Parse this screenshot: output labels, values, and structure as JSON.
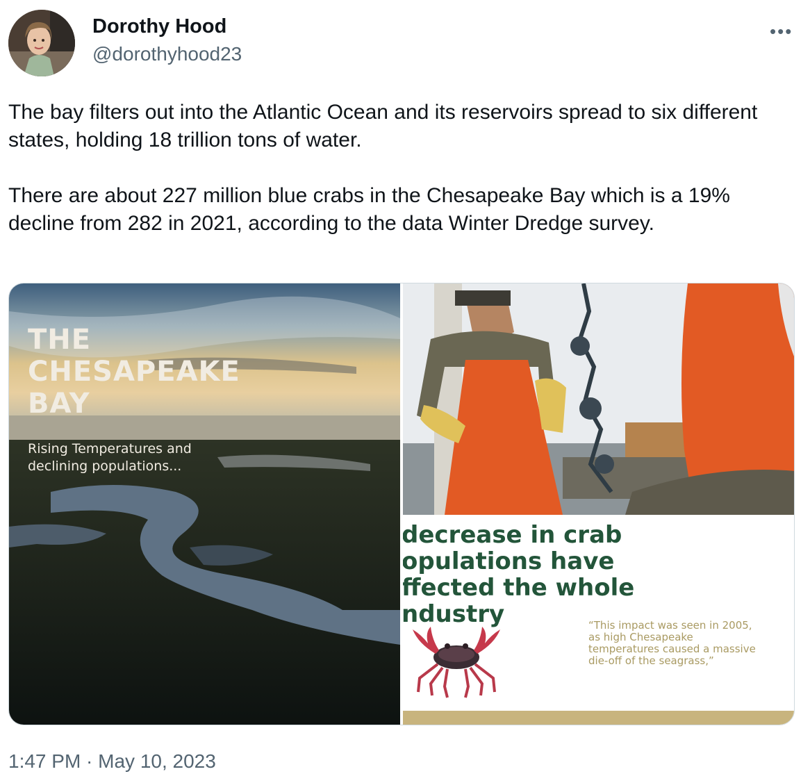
{
  "author": {
    "name": "Dorothy Hood",
    "handle": "@dorothyhood23",
    "avatar_icon": "profile-photo"
  },
  "more_icon": "more-horizontal-icon",
  "tweet": {
    "paragraph1": "The bay filters out into the Atlantic Ocean and its reservoirs spread to six different states, holding 18 trillion tons of water.",
    "paragraph2": "There are about 227 million blue crabs in the Chesapeake Bay which is a 19% decline from 282 in 2021, according to the data Winter Dredge survey."
  },
  "media": {
    "left": {
      "title_line1": "THE",
      "title_line2": "CHESAPEAKE",
      "title_line3": "BAY",
      "subtitle_line1": "Rising Temperatures and",
      "subtitle_line2": "declining populations..."
    },
    "right": {
      "headline_line1": "decrease in crab",
      "headline_line2": "opulations have",
      "headline_line3": "ffected the whole",
      "headline_line4": "ndustry",
      "quote_line1": "“This impact was seen in 2005,",
      "quote_line2": "as high Chesapeake",
      "quote_line3": "temperatures caused a massive",
      "quote_line4": "die-off of the seagrass,”"
    }
  },
  "timestamp": "1:47 PM · May 10, 2023",
  "colors": {
    "text": "#0f1419",
    "secondary": "#536471",
    "headline_green": "#23553a",
    "gold": "#c8b47e"
  }
}
